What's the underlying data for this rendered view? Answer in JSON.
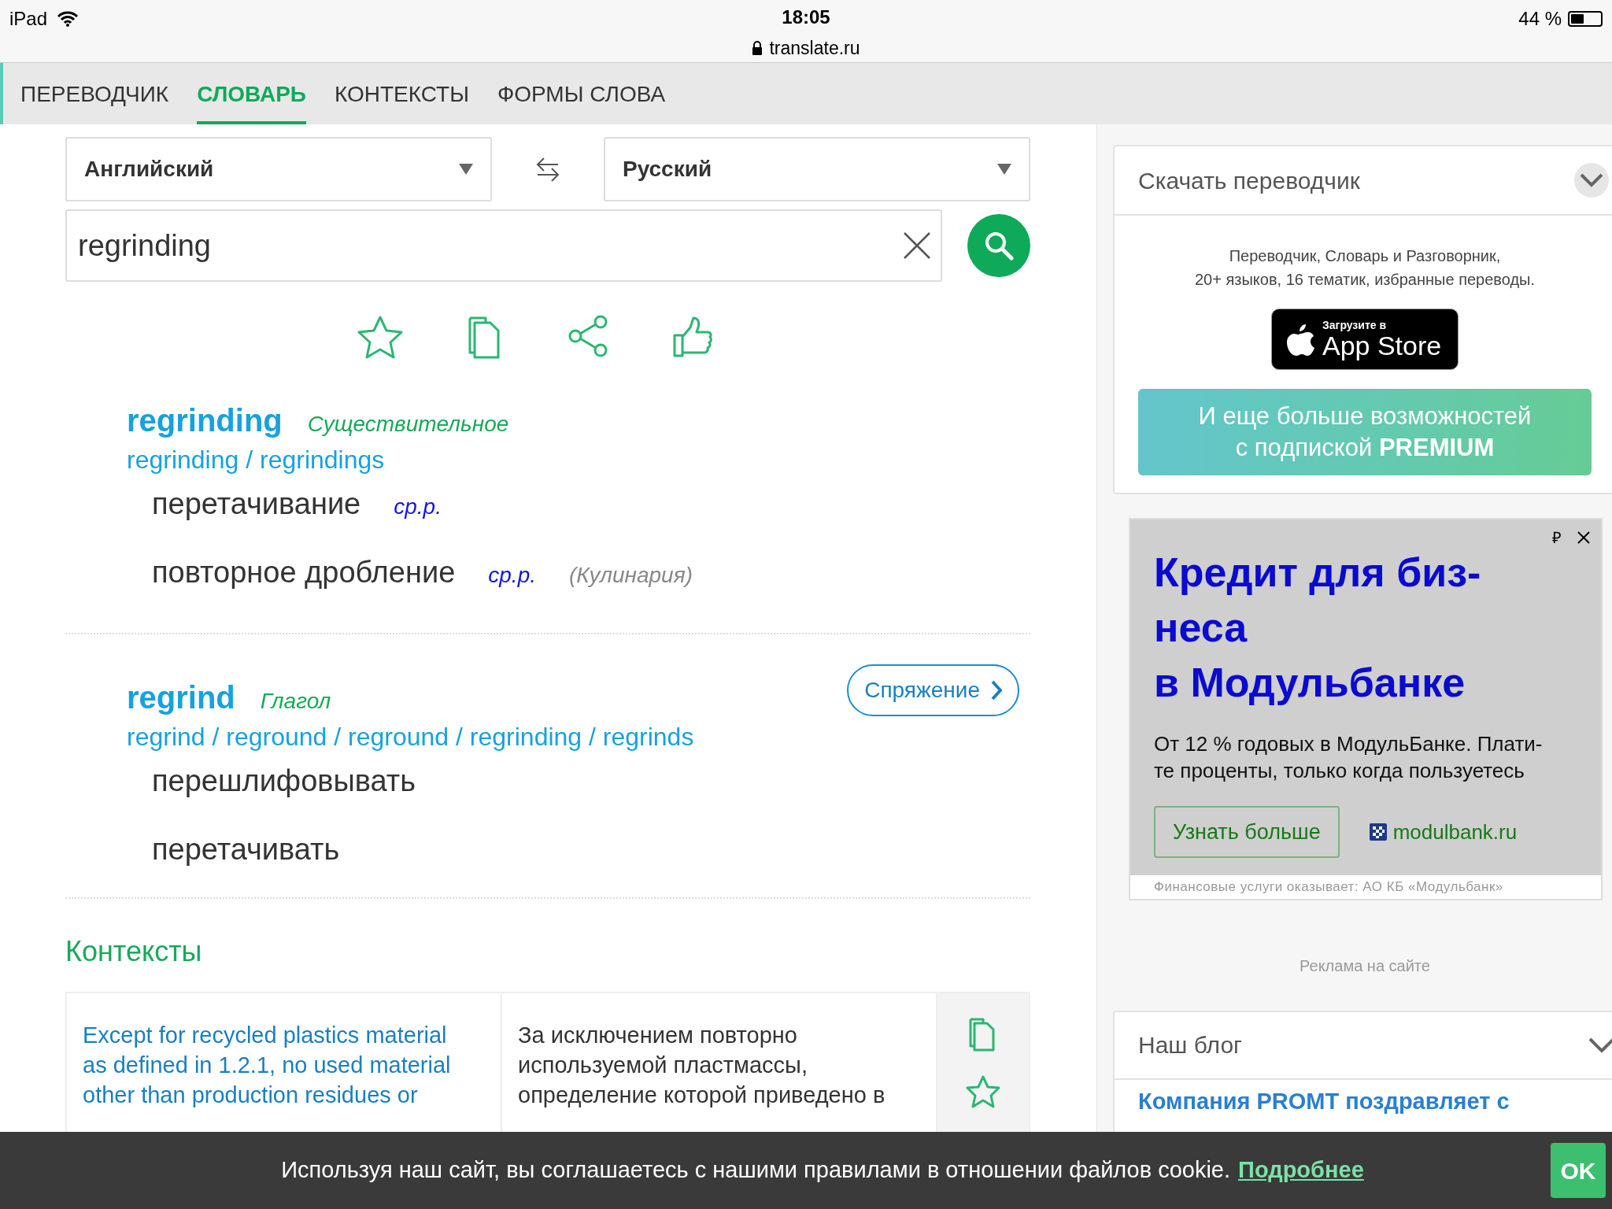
{
  "status_bar": {
    "device": "iPad",
    "time": "18:05",
    "url": "translate.ru",
    "battery": "44 %"
  },
  "tabs": [
    {
      "label": "ПЕРЕВОДЧИК",
      "selected": false
    },
    {
      "label": "СЛОВАРЬ",
      "selected": true
    },
    {
      "label": "КОНТЕКСТЫ",
      "selected": false
    },
    {
      "label": "ФОРМЫ СЛОВА",
      "selected": false
    }
  ],
  "languages": {
    "source": "Английский",
    "target": "Русский"
  },
  "search": {
    "value": "regrinding"
  },
  "entries": [
    {
      "word": "regrinding",
      "pos": "Существительное",
      "forms": "regrinding / regrindings",
      "translations": [
        {
          "text": "перетачивание",
          "gender": "ср.р."
        },
        {
          "text": "повторное дробление",
          "gender": "ср.р.",
          "domain": "(Кулинария)"
        }
      ]
    },
    {
      "word": "regrind",
      "pos": "Глагол",
      "forms": "regrind / reground / reground / regrinding / regrinds",
      "conjugation": "Спряжение",
      "translations": [
        {
          "text": "перешлифовывать"
        },
        {
          "text": "перетачивать"
        }
      ]
    }
  ],
  "contexts": {
    "title": "Контексты",
    "rows": [
      {
        "source": "Except for recycled plastics material\nas defined in 1.2.1, no used material\nother than production residues or",
        "target": "За исключением повторно\nиспользуемой пластмассы,\nопределение которой приведено в"
      }
    ]
  },
  "download_card": {
    "title": "Скачать переводчик",
    "description": "Переводчик, Словарь и Разговорник,\n20+ языков, 16 тематик, избранные переводы.",
    "app_store_small": "Загрузите в",
    "app_store_big": "App Store",
    "premium": "И еще больше возможностей\nс подпиской **PREMIUM**"
  },
  "ad": {
    "currency": "₽",
    "headline": "Кредит для биз-\nнеса\nв Модульбанке",
    "text": "От 12 % годовых в МодульБанке. Плати-\nте проценты, только когда пользуетесь",
    "button": "Узнать больше",
    "domain": "modulbank.ru",
    "disclaimer": "Финансовые услуги оказывает: АО КБ «Модульбанк»"
  },
  "ad_label": "Реклама на сайте",
  "blog": {
    "title": "Наш блог",
    "post_title": "Компания PROMT поздравляет с"
  },
  "cookie": {
    "text": "Используя наш сайт, вы соглашаетесь с нашими правилами в отношении файлов cookie.",
    "link": "Подробнее",
    "ok": "OK"
  }
}
